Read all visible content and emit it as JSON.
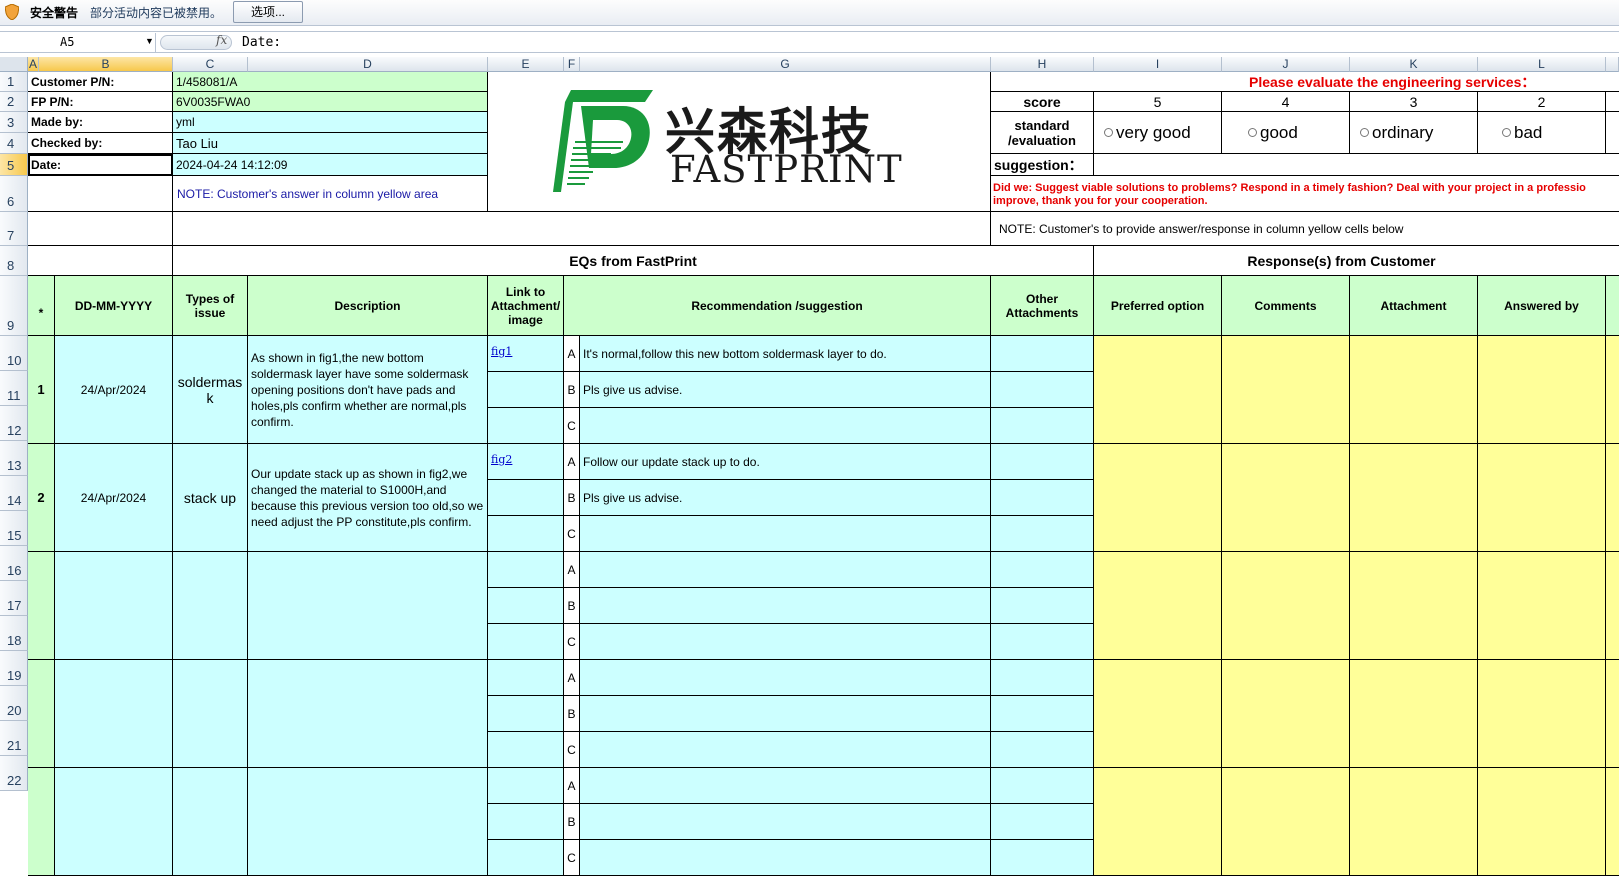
{
  "security_bar": {
    "title": "安全警告",
    "message": "部分活动内容已被禁用。",
    "options_button": "选项..."
  },
  "formula_bar": {
    "name_box": "A5",
    "fx_label": "fx",
    "content": "Date:"
  },
  "columns": [
    "A",
    "B",
    "C",
    "D",
    "E",
    "F",
    "G",
    "H",
    "I",
    "J",
    "K",
    "L"
  ],
  "rows": [
    "1",
    "2",
    "3",
    "4",
    "5",
    "6",
    "7",
    "8",
    "9",
    "10",
    "11",
    "12",
    "13",
    "14",
    "15",
    "16",
    "17",
    "18",
    "19",
    "20",
    "21",
    "22"
  ],
  "header_info": {
    "customer_pn_label": "Customer P/N:",
    "customer_pn": "1/458081/A",
    "fp_pn_label": "FP P/N:",
    "fp_pn": "6V0035FWA0",
    "made_by_label": "Made by:",
    "made_by": "yml",
    "checked_by_label": "Checked by:",
    "checked_by": "Tao Liu",
    "date_label": "Date:",
    "date": "2024-04-24 14:12:09",
    "note_customer": "NOTE: Customer's  answer in column yellow area"
  },
  "logo": {
    "chinese": "兴森科技",
    "english": "FASTPRINT"
  },
  "evaluation": {
    "title": "Please evaluate the engineering services：",
    "score_label": "score",
    "scores": [
      "5",
      "4",
      "3",
      "2"
    ],
    "standard_label": "standard /evaluation",
    "options": [
      "very good",
      "good",
      "ordinary",
      "bad"
    ],
    "suggestion_label": "suggestion：",
    "did_we_line1": "Did we: Suggest viable solutions to problems? Respond in a timely fashion? Deal with your project in a professio",
    "did_we_line2": "improve, thank you for your cooperation.",
    "note_response": "NOTE: Customer's to provide answer/response in column yellow cells below"
  },
  "sections": {
    "eqs": "EQs from FastPrint",
    "responses": "Response(s) from Customer"
  },
  "table_headers": {
    "star": "*",
    "date": "DD-MM-YYYY",
    "types": "Types of issue",
    "description": "Description",
    "link": "Link to Attachment/ image",
    "recommendation": "Recommendation /suggestion",
    "other": "Other Attachments",
    "preferred": "Preferred option",
    "comments": "Comments",
    "attachment": "Attachment",
    "answered_by": "Answered by"
  },
  "eqs": [
    {
      "no": "1",
      "date": "24/Apr/2024",
      "type": "soldermask",
      "description": "As shown in fig1,the new bottom soldermask layer have some soldermask opening positions don't have pads and holes,pls confirm whether are normal,pls confirm.",
      "link": "fig1",
      "options": [
        {
          "letter": "A",
          "text": "It's normal,follow this new bottom soldermask layer to do."
        },
        {
          "letter": "B",
          "text": "Pls give us advise."
        },
        {
          "letter": "C",
          "text": ""
        }
      ]
    },
    {
      "no": "2",
      "date": "24/Apr/2024",
      "type": "stack up",
      "description": "Our update stack up as shown in fig2,we changed the material to S1000H,and because this previous version too old,so we need adjust the PP constitute,pls confirm.",
      "link": "fig2",
      "options": [
        {
          "letter": "A",
          "text": "Follow our update stack up to do."
        },
        {
          "letter": "B",
          "text": "Pls give us advise."
        },
        {
          "letter": "C",
          "text": ""
        }
      ]
    }
  ],
  "empty_letters": [
    "A",
    "B",
    "C"
  ],
  "colors": {
    "green": "#ccffcc",
    "cyan": "#ccffff",
    "yellow": "#ffff99",
    "red_text": "#e60000",
    "selected_header": "#f7c84c"
  }
}
